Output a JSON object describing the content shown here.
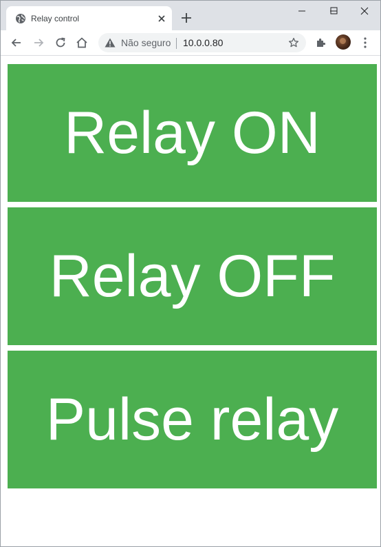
{
  "browser": {
    "tab_title": "Relay control",
    "security_status": "Não seguro",
    "url": "10.0.0.80"
  },
  "icons": {
    "favicon": "globe-icon",
    "tab_close": "close-icon",
    "new_tab": "plus-icon",
    "back": "arrow-left-icon",
    "forward": "arrow-right-icon",
    "reload": "reload-icon",
    "home": "home-icon",
    "warning": "warning-triangle-icon",
    "bookmark": "star-icon",
    "extensions": "puzzle-icon",
    "menu": "kebab-menu-icon"
  },
  "page": {
    "buttons": [
      {
        "label": "Relay ON"
      },
      {
        "label": "Relay OFF"
      },
      {
        "label": "Pulse relay"
      }
    ]
  },
  "colors": {
    "button_bg": "#4caf50",
    "button_text": "#ffffff",
    "tabstrip": "#dee1e6"
  }
}
